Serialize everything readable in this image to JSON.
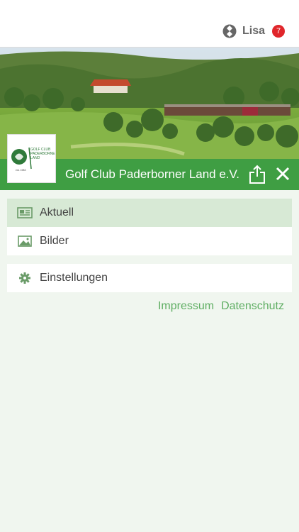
{
  "header": {
    "user_name": "Lisa",
    "notification_count": "7"
  },
  "club": {
    "title": "Golf Club Paderborner Land e.V.",
    "logo_text_line1": "GOLF CLUB",
    "logo_text_line2": "PADERBORNER",
    "logo_text_line3": "LAND",
    "logo_est": "est. 1983"
  },
  "menu": {
    "items": [
      {
        "label": "Aktuell",
        "icon": "newspaper-icon",
        "active": true
      },
      {
        "label": "Bilder",
        "icon": "image-icon",
        "active": false
      },
      {
        "label": "Einstellungen",
        "icon": "gear-icon",
        "active": false
      }
    ]
  },
  "footer": {
    "impressum": "Impressum",
    "datenschutz": "Datenschutz"
  },
  "colors": {
    "accent_green": "#3f9e43",
    "link_green": "#5fae63",
    "badge_red": "#e0262b"
  }
}
